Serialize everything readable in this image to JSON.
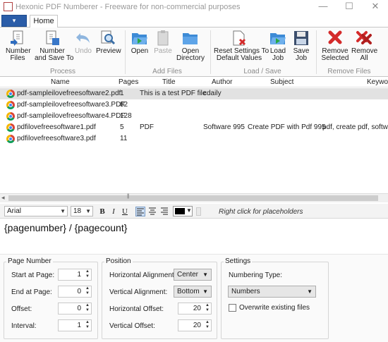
{
  "window": {
    "title": "Hexonic PDF Numberer - Freeware for non-commercial purposes",
    "minimize": "—",
    "maximize": "☐",
    "close": "✕"
  },
  "tabs": {
    "file": "▾",
    "home": "Home"
  },
  "ribbon": {
    "number_files": "Number\nFiles",
    "number_files_l1": "Number",
    "number_files_l2": "Files",
    "number_save_l1": "Number",
    "number_save_l2": "and Save To",
    "undo": "Undo",
    "preview": "Preview",
    "open": "Open",
    "paste": "Paste",
    "open_dir_l1": "Open",
    "open_dir_l2": "Directory",
    "reset_l1": "Reset Settings To",
    "reset_l2": "Default Values",
    "load_l1": "Load",
    "load_l2": "Job",
    "save_l1": "Save",
    "save_l2": "Job",
    "remove_sel_l1": "Remove",
    "remove_sel_l2": "Selected",
    "remove_all_l1": "Remove",
    "remove_all_l2": "All",
    "group_process": "Process",
    "group_add_files": "Add Files",
    "group_load_save": "Load / Save",
    "group_remove_files": "Remove Files"
  },
  "table": {
    "headers": {
      "name": "Name",
      "pages": "Pages",
      "title": "Title",
      "author": "Author",
      "subject": "Subject",
      "keywords": "Keywor"
    },
    "rows": [
      {
        "name": "pdf-sampleilovefreesoftware2.pdf",
        "pages": "1",
        "title": "This is a test PDF file",
        "author": "cdaily",
        "subject": "",
        "keywords": ""
      },
      {
        "name": "pdf-sampleilovefreesoftware3.PDF",
        "pages": "82",
        "title": "",
        "author": "",
        "subject": "",
        "keywords": ""
      },
      {
        "name": "pdf-sampleilovefreesoftware4.PDF",
        "pages": "128",
        "title": "",
        "author": "",
        "subject": "",
        "keywords": ""
      },
      {
        "name": "pdfilovefreesoftware1.pdf",
        "pages": "5",
        "title": "PDF",
        "author": "Software 995",
        "subject": "Create PDF with Pdf 995",
        "keywords": "pdf, create pdf, softwa"
      },
      {
        "name": "pdfilovefreesoftware3.pdf",
        "pages": "11",
        "title": "",
        "author": "",
        "subject": "",
        "keywords": ""
      }
    ]
  },
  "scroll": {
    "left": "◂",
    "grip": "|||"
  },
  "editbar": {
    "font": "Arial",
    "size": "18",
    "bold": "B",
    "italic": "I",
    "underline": "U",
    "hint": "Right click for placeholders"
  },
  "editor": {
    "text": "{pagenumber} / {pagecount}"
  },
  "page_number": {
    "legend": "Page Number",
    "start_label": "Start at Page:",
    "start_value": "1",
    "end_label": "End at Page:",
    "end_value": "0",
    "offset_label": "Offset:",
    "offset_value": "0",
    "interval_label": "Interval:",
    "interval_value": "1"
  },
  "position": {
    "legend": "Position",
    "h_align_label": "Horizontal Alignment:",
    "h_align_value": "Center",
    "v_align_label": "Vertical Alignment:",
    "v_align_value": "Bottom",
    "h_offset_label": "Horizontal Offset:",
    "h_offset_value": "20",
    "v_offset_label": "Vertical Offset:",
    "v_offset_value": "20"
  },
  "settings": {
    "legend": "Settings",
    "numbering_type_label": "Numbering Type:",
    "numbering_type_value": "Numbers",
    "overwrite_label": "Overwrite existing files",
    "overwrite_checked": false
  },
  "colors": {
    "file_tab": "#2b5da8",
    "selected_row": "#e2e2e2",
    "remove_red": "#d42a2a",
    "folder_blue": "#3d8bd6",
    "text_color_swatch": "#000000"
  }
}
